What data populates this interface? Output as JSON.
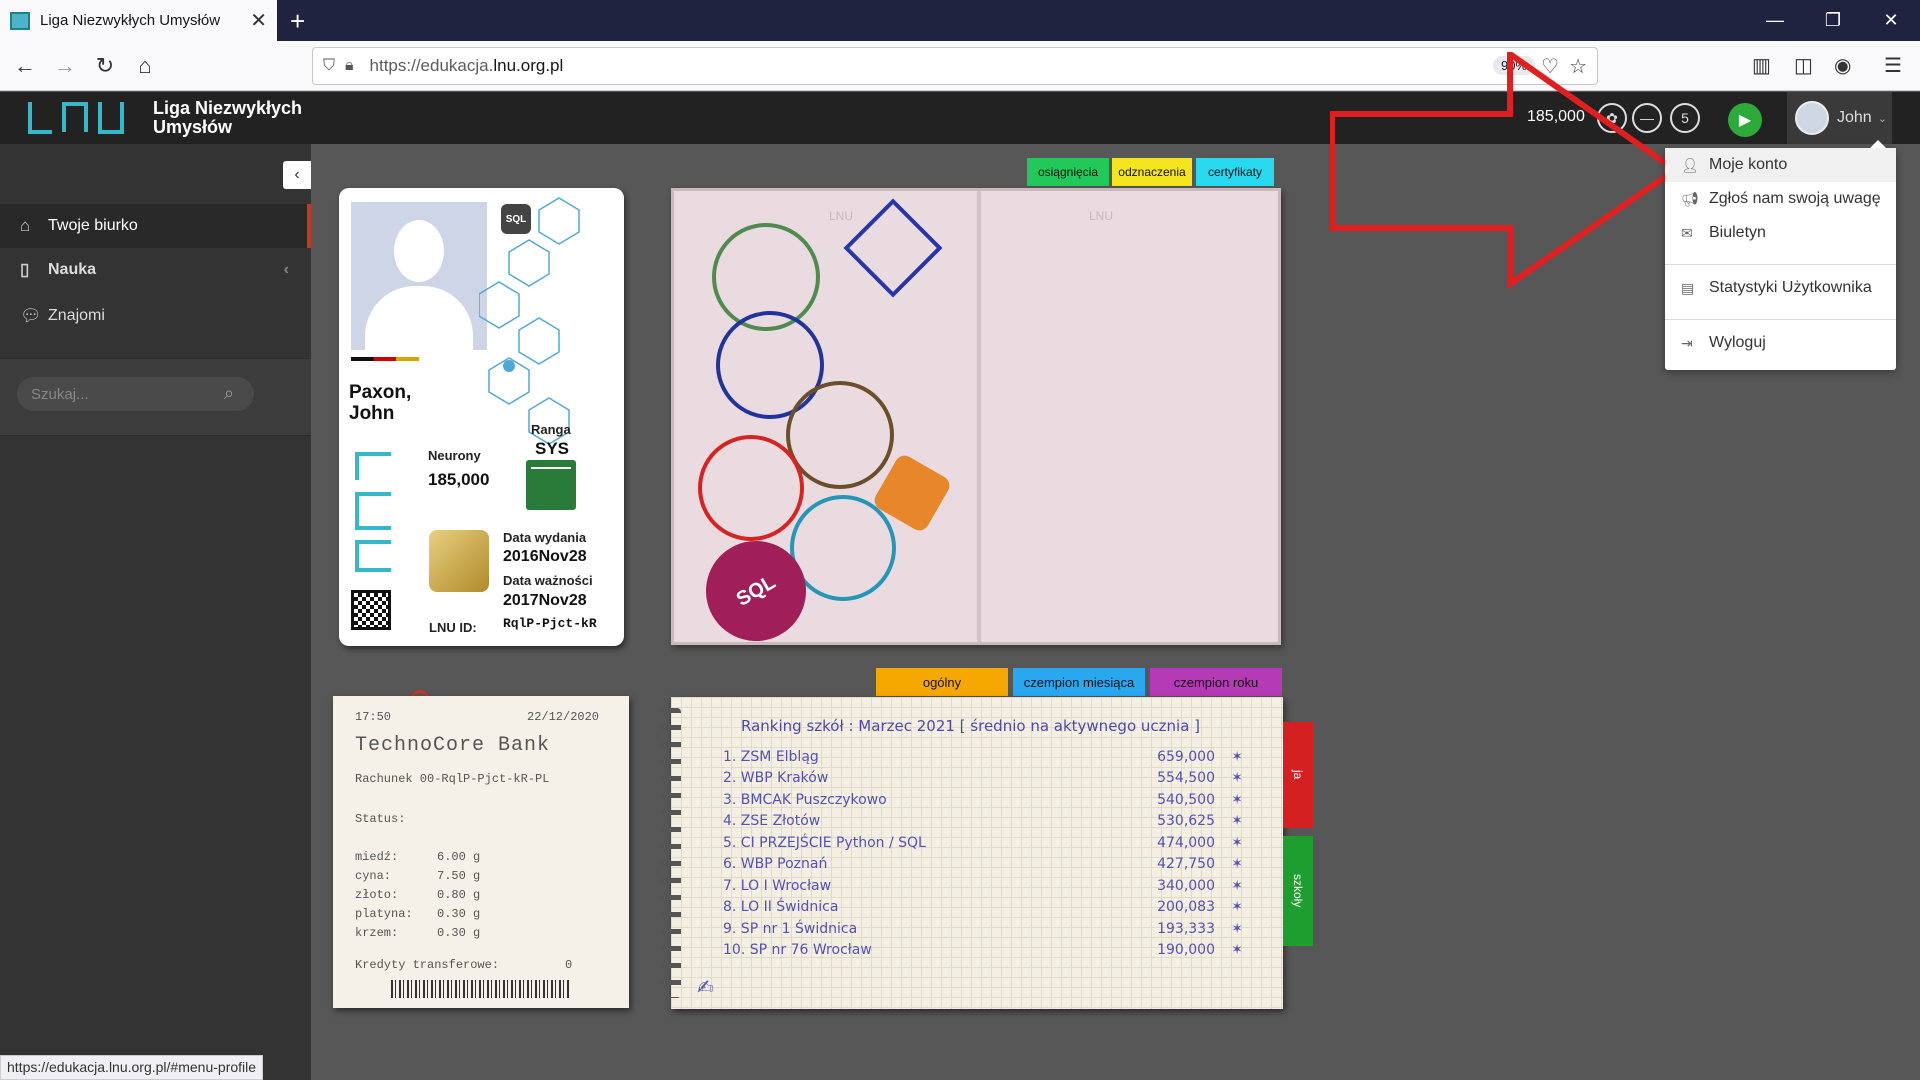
{
  "browser": {
    "tab_title": "Liga Niezwykłych Umysłów",
    "url_prefix": "https://edukacja.",
    "url_domain": "lnu.org.pl",
    "zoom": "90%",
    "status_url": "https://edukacja.lnu.org.pl/#menu-profile"
  },
  "app": {
    "logo_line1": "Liga Niezwykłych",
    "logo_line2": "Umysłów",
    "neurons": "185,000",
    "rank_5": "5",
    "user_name": "John"
  },
  "sidebar": {
    "items": [
      {
        "label": "Twoje biurko"
      },
      {
        "label": "Nauka"
      },
      {
        "label": "Znajomi"
      }
    ],
    "search_placeholder": "Szukaj..."
  },
  "id_card": {
    "name_line1": "Paxon,",
    "name_line2": "John",
    "rank_label": "Ranga",
    "rank_value": "SYS",
    "neurons_label": "Neurony",
    "neurons_value": "185,000",
    "issue_label": "Data wydania",
    "issue_value": "2016Nov28",
    "valid_label": "Data ważności",
    "valid_value": "2017Nov28",
    "lnu_id_label": "LNU ID:",
    "lnu_id_value": "RqlP-Pjct-kR",
    "sql_badge": "SQL"
  },
  "passport_tabs": [
    "osiągnięcia",
    "odznaczenia",
    "certyfikaty"
  ],
  "passport": {
    "watermark": "LNU"
  },
  "receipt": {
    "time": "17:50",
    "date": "22/12/2020",
    "bank": "TechnoCore Bank",
    "account": "Rachunek 00-RqlP-Pjct-kR-PL",
    "status_label": "Status:",
    "items": [
      {
        "name": "miedź:",
        "value": "6.00 g"
      },
      {
        "name": "cyna:",
        "value": "7.50 g"
      },
      {
        "name": "złoto:",
        "value": "0.80 g"
      },
      {
        "name": "platyna:",
        "value": "0.30 g"
      },
      {
        "name": "krzem:",
        "value": "0.30 g"
      }
    ],
    "credits_label": "Kredyty transferowe:",
    "credits_value": "0"
  },
  "ranking_tabs": [
    "ogólny",
    "czempion miesiąca",
    "czempion roku"
  ],
  "ranking": {
    "title": "Ranking szkół : Marzec 2021 [ średnio na aktywnego ucznia ]",
    "rows": [
      {
        "name": "1. ZSM Elbląg",
        "value": "659,000"
      },
      {
        "name": "2. WBP Kraków",
        "value": "554,500"
      },
      {
        "name": "3. BMCAK Puszczykowo",
        "value": "540,500"
      },
      {
        "name": "4. ZSE Złotów",
        "value": "530,625"
      },
      {
        "name": "5. CI PRZEJŚCIE Python / SQL",
        "value": "474,000"
      },
      {
        "name": "6. WBP Poznań",
        "value": "427,750"
      },
      {
        "name": "7. LO I Wrocław",
        "value": "340,000"
      },
      {
        "name": "8. LO II Świdnica",
        "value": "200,083"
      },
      {
        "name": "9. SP nr 1 Świdnica",
        "value": "193,333"
      },
      {
        "name": "10. SP nr 76 Wrocław",
        "value": "190,000"
      }
    ],
    "star": "✶",
    "side_tab_ja": "ja",
    "side_tab_szkoly": "szkoły"
  },
  "dropdown": {
    "items": [
      {
        "label": "Moje konto"
      },
      {
        "label": "Zgłoś nam swoją uwagę"
      },
      {
        "label": "Biuletyn"
      },
      {
        "label": "Statystyki Użytkownika"
      },
      {
        "label": "Wyloguj"
      }
    ]
  },
  "colors": {
    "tab_green": "#23c85a",
    "tab_yellow": "#f5e51e",
    "tab_cyan": "#28d9f0",
    "tab_orange": "#f5a800",
    "tab_blue": "#29a8f0",
    "tab_purple": "#b53ab5",
    "side_red": "#d42020",
    "side_green": "#1e9e2e",
    "annotation_red": "#e02020"
  }
}
